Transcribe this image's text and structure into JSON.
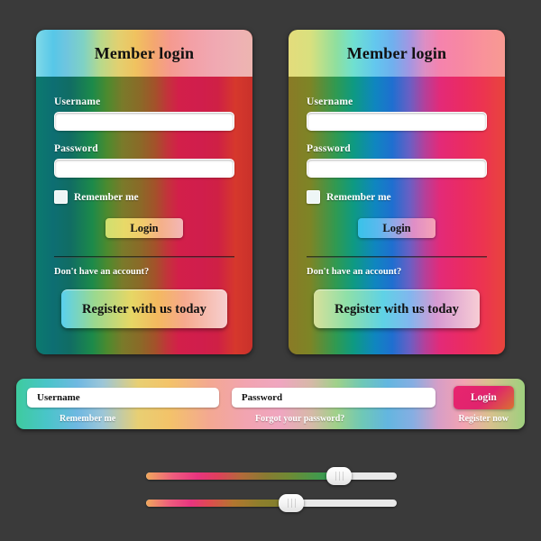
{
  "theme": {
    "page_background": "#3a3a3a",
    "card_text": "#ffffff",
    "header_text": "#111111",
    "bar_login_accent": "#e8256f"
  },
  "cards": [
    {
      "id": "card-1",
      "title": "Member login",
      "username_label": "Username",
      "username_value": "",
      "password_label": "Password",
      "password_value": "",
      "remember_label": "Remember me",
      "login_label": "Login",
      "no_account_label": "Don't have an account?",
      "register_label": "Register with us today"
    },
    {
      "id": "card-2",
      "title": "Member login",
      "username_label": "Username",
      "username_value": "",
      "password_label": "Password",
      "password_value": "",
      "remember_label": "Remember me",
      "login_label": "Login",
      "no_account_label": "Don't have an account?",
      "register_label": "Register with us today"
    }
  ],
  "horizontal_bar": {
    "username_placeholder": "Username",
    "username_value": "Username",
    "password_placeholder": "Password",
    "password_value": "Password",
    "login_label": "Login",
    "remember_label": "Remember me",
    "forgot_label": "Forgot your password?",
    "register_label": "Register now"
  },
  "sliders": [
    {
      "id": "slider-1",
      "value_percent": 72,
      "fill_percent": 79
    },
    {
      "id": "slider-2",
      "value_percent": 53,
      "fill_percent": 60
    }
  ]
}
